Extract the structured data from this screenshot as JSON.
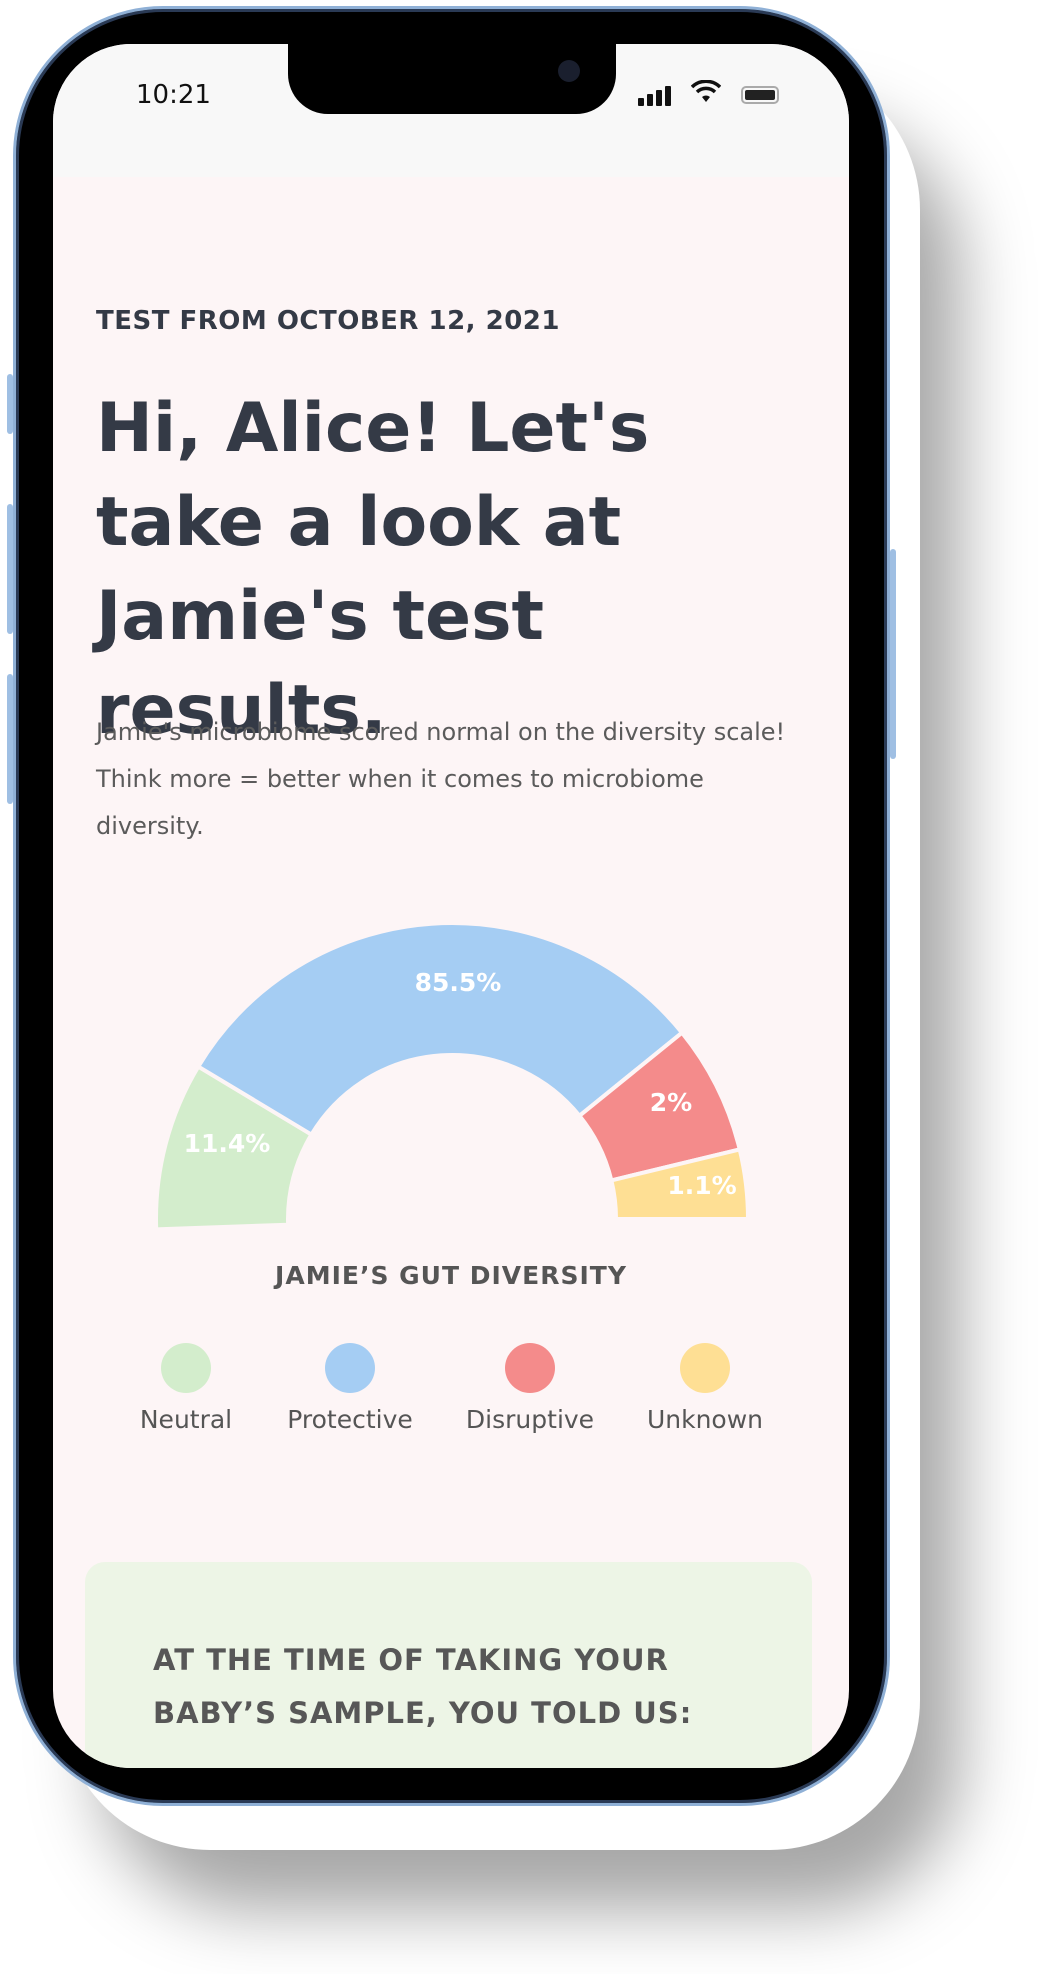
{
  "status_bar": {
    "time": "10:21",
    "icons": [
      "signal-icon",
      "wifi-icon",
      "battery-icon"
    ]
  },
  "header": {
    "date": "TEST FROM OCTOBER 12, 2021",
    "title": "Hi, Alice! Let's take a look at Jamie's test results.",
    "description": "Jamie's microbiome scored normal on the diversity scale! Think more = better when it comes to microbiome diversity."
  },
  "chart_data": {
    "type": "pie",
    "variant": "half-donut",
    "title": "JAMIE’S GUT DIVERSITY",
    "categories": [
      "Neutral",
      "Protective",
      "Disruptive",
      "Unknown"
    ],
    "values": [
      11.4,
      85.5,
      2,
      1.1
    ],
    "labels": [
      "11.4%",
      "85.5%",
      "2%",
      "1.1%"
    ],
    "colors": [
      "#d3edcc",
      "#a5cdf3",
      "#f48b8b",
      "#fedf94"
    ],
    "legend_position": "bottom"
  },
  "card": {
    "text": "AT THE TIME OF TAKING YOUR BABY’S SAMPLE, YOU TOLD US:"
  }
}
